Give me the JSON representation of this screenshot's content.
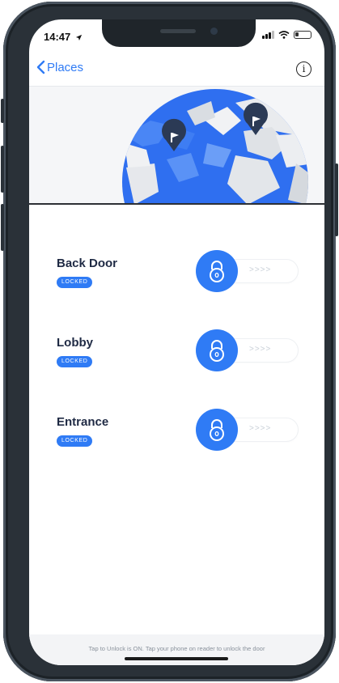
{
  "status": {
    "time": "14:47"
  },
  "nav": {
    "back_label": "Places",
    "info_icon": "info-icon"
  },
  "locks": [
    {
      "name": "Back Door",
      "status": "LOCKED",
      "slider_hint": ">>>>"
    },
    {
      "name": "Lobby",
      "status": "LOCKED",
      "slider_hint": ">>>>"
    },
    {
      "name": "Entrance",
      "status": "LOCKED",
      "slider_hint": ">>>>"
    }
  ],
  "footer": {
    "hint": "Tap to Unlock is ON. Tap your phone on reader to unlock the door"
  },
  "colors": {
    "accent": "#2f7bf5",
    "title": "#1f2a44",
    "frame": "#2a3138"
  }
}
